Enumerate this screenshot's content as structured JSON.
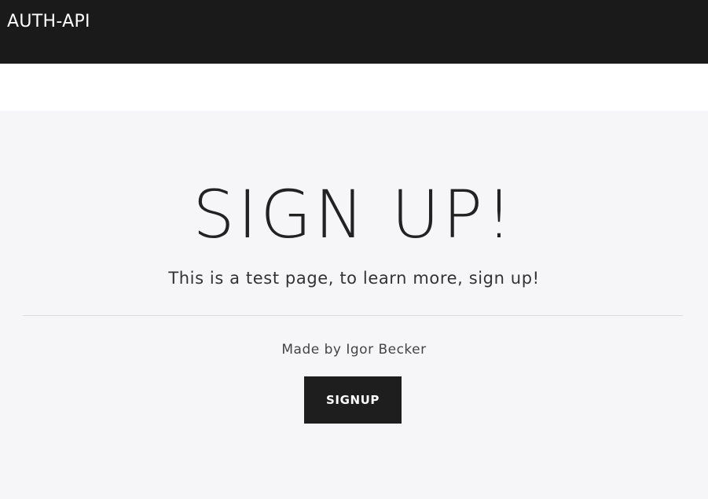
{
  "navbar": {
    "brand": "AUTH-API"
  },
  "hero": {
    "headline": "SIGN UP!",
    "lead": "This is a test page, to learn more, sign up!",
    "credit": "Made by Igor Becker",
    "button_label": "SIGNUP"
  },
  "colors": {
    "navbar_bg": "#1a1a1a",
    "hero_bg": "#f6f6f8",
    "button_bg": "#1e1e1e",
    "text_dark": "#222222"
  }
}
